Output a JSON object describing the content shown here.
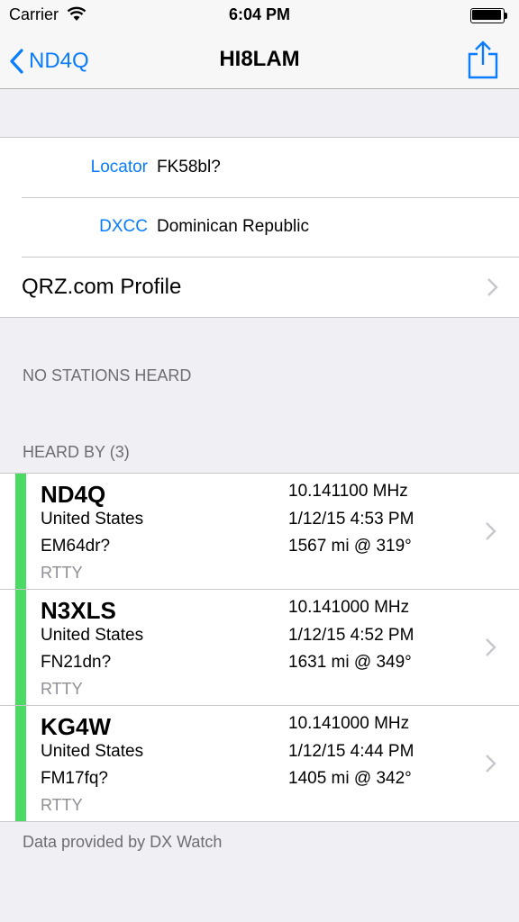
{
  "status_bar": {
    "carrier": "Carrier",
    "time": "6:04 PM",
    "wifi_icon": "wifi-icon",
    "battery_icon": "battery-icon"
  },
  "nav": {
    "back_label": "ND4Q",
    "title": "HI8LAM",
    "share_icon": "share-icon",
    "accent_color": "#0a7cff"
  },
  "info": {
    "locator_label": "Locator",
    "locator_value": "FK58bl?",
    "dxcc_label": "DXCC",
    "dxcc_value": "Dominican Republic",
    "qrz_label": "QRZ.com Profile"
  },
  "sections": {
    "no_stations": "NO STATIONS HEARD",
    "heard_by": "HEARD BY (3)"
  },
  "stations": [
    {
      "call": "ND4Q",
      "country": "United States",
      "grid": "EM64dr?",
      "mode": "RTTY",
      "freq": "10.141100 MHz",
      "time": "1/12/15 4:53 PM",
      "distance": "1567 mi @ 319°"
    },
    {
      "call": "N3XLS",
      "country": "United States",
      "grid": "FN21dn?",
      "mode": "RTTY",
      "freq": "10.141000 MHz",
      "time": "1/12/15 4:52 PM",
      "distance": "1631 mi @ 349°"
    },
    {
      "call": "KG4W",
      "country": "United States",
      "grid": "FM17fq?",
      "mode": "RTTY",
      "freq": "10.141000 MHz",
      "time": "1/12/15 4:44 PM",
      "distance": "1405 mi @ 342°"
    }
  ],
  "stripe_color": "#4cd964",
  "footer": "Data provided by DX Watch"
}
